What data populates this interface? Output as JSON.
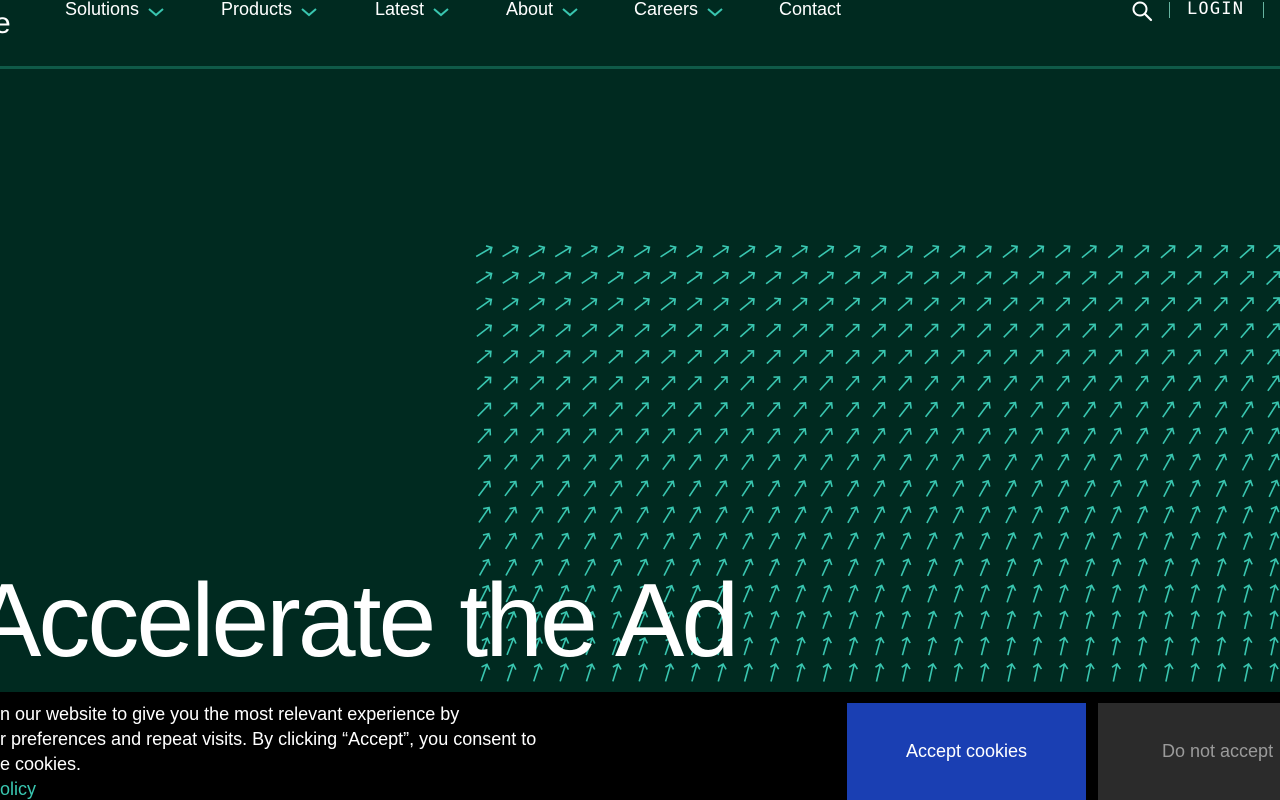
{
  "header": {
    "logo_fragment": "e",
    "nav": [
      {
        "label": "Solutions",
        "dropdown": true
      },
      {
        "label": "Products",
        "dropdown": true
      },
      {
        "label": "Latest",
        "dropdown": true
      },
      {
        "label": "About",
        "dropdown": true
      },
      {
        "label": "Careers",
        "dropdown": true
      },
      {
        "label": "Contact",
        "dropdown": false
      }
    ],
    "search_icon": "search-icon",
    "login_label": "LOGIN"
  },
  "hero": {
    "title": "Accelerate the Ad"
  },
  "cookie_banner": {
    "lines": [
      "on our website to give you the most relevant experience by",
      "ur preferences and repeat visits. By clicking “Accept”, you consent to",
      "he cookies."
    ],
    "link_label": "policy",
    "accept_label": "Accept cookies",
    "decline_label": "Do not accept"
  },
  "colors": {
    "background": "#002a20",
    "accent": "#39c6b0",
    "accept_button": "#1a3fb3",
    "decline_button": "#2b2b2b",
    "banner": "#000000"
  }
}
